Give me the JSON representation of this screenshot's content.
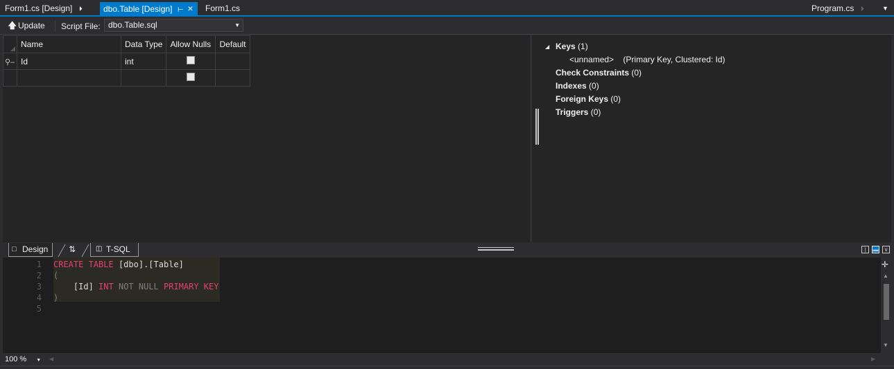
{
  "tabs": {
    "form1_design": "Form1.cs [Design]",
    "table_design": "dbo.Table [Design]",
    "form1": "Form1.cs",
    "program": "Program.cs"
  },
  "toolbar": {
    "update_label": "Update",
    "script_file_label": "Script File:",
    "script_file_value": "dbo.Table.sql"
  },
  "grid": {
    "headers": [
      "Name",
      "Data Type",
      "Allow Nulls",
      "Default"
    ],
    "rows": [
      {
        "name": "Id",
        "data_type": "int",
        "allow_nulls": false,
        "default": "",
        "primary_key": true
      },
      {
        "name": "",
        "data_type": "",
        "allow_nulls": false,
        "default": "",
        "primary_key": false
      }
    ]
  },
  "keys_pane": {
    "keys_label": "Keys",
    "keys_count": "(1)",
    "key_name": "<unnamed>",
    "key_detail": "(Primary Key, Clustered: Id)",
    "check_constraints_label": "Check Constraints",
    "check_constraints_count": "(0)",
    "indexes_label": "Indexes",
    "indexes_count": "(0)",
    "foreign_keys_label": "Foreign Keys",
    "foreign_keys_count": "(0)",
    "triggers_label": "Triggers",
    "triggers_count": "(0)"
  },
  "view_tabs": {
    "design": "Design",
    "tsql": "T-SQL"
  },
  "editor": {
    "line_numbers": [
      "1",
      "2",
      "3",
      "4",
      "5"
    ],
    "line1": {
      "kw1": "CREATE",
      "kw2": "TABLE",
      "rest": "[dbo].[Table]"
    },
    "line2": "(",
    "line3": {
      "ident": "[Id]",
      "type": "INT",
      "notnull": "NOT NULL",
      "pk": "PRIMARY KEY"
    },
    "line4": ")"
  },
  "status": {
    "zoom": "100 %"
  },
  "colors": {
    "accent": "#007acc",
    "keyword": "#e53f73",
    "editor_bg": "#1e1e1e",
    "chrome_bg": "#2d2d30"
  }
}
